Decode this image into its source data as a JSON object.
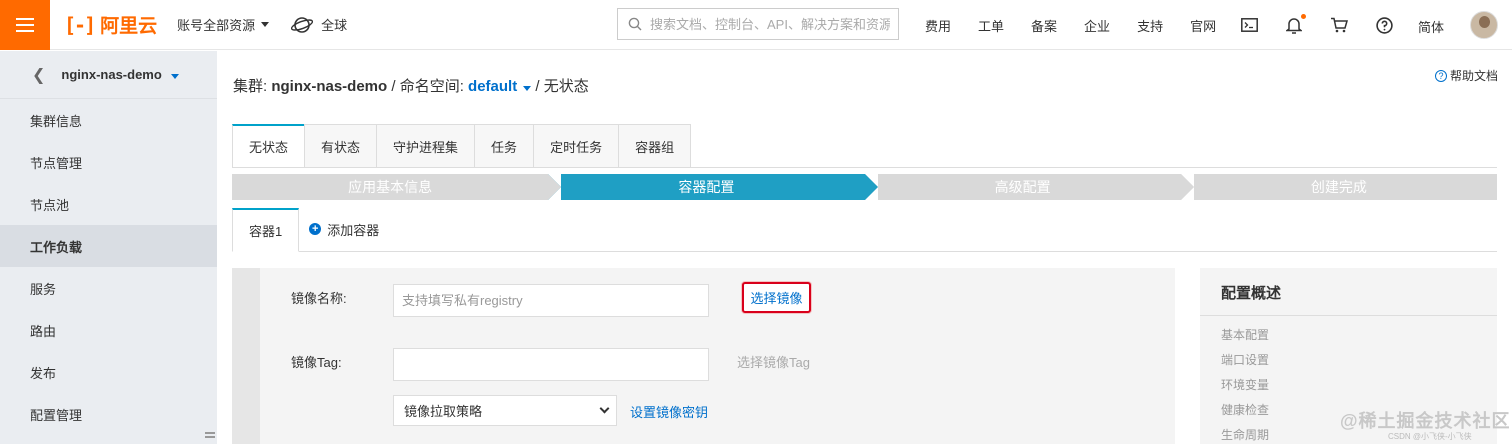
{
  "topbar": {
    "logo_mark": "[-]",
    "logo_text": "阿里云",
    "account_label": "账号全部资源",
    "region_label": "全球",
    "search_placeholder": "搜索文档、控制台、API、解决方案和资源",
    "nav": [
      "费用",
      "工单",
      "备案",
      "企业",
      "支持",
      "官网"
    ],
    "language": "简体",
    "accent": "#ff6a00"
  },
  "sidebar": {
    "cluster_name": "nginx-nas-demo",
    "items": [
      {
        "label": "集群信息"
      },
      {
        "label": "节点管理"
      },
      {
        "label": "节点池"
      },
      {
        "label": "工作负载",
        "active": true
      },
      {
        "label": "服务"
      },
      {
        "label": "路由"
      },
      {
        "label": "发布"
      },
      {
        "label": "配置管理"
      }
    ]
  },
  "breadcrumb": {
    "cluster_prefix": "集群:",
    "cluster": "nginx-nas-demo",
    "sep1": "/",
    "namespace_prefix": "命名空间:",
    "namespace": "default",
    "sep2": "/",
    "current": "无状态"
  },
  "help_link": "帮助文档",
  "tabs": [
    "无状态",
    "有状态",
    "守护进程集",
    "任务",
    "定时任务",
    "容器组"
  ],
  "steps": [
    "应用基本信息",
    "容器配置",
    "高级配置",
    "创建完成"
  ],
  "active_step": 1,
  "container_tabs": {
    "current": "容器1",
    "add_label": "添加容器"
  },
  "form": {
    "image_name_label": "镜像名称:",
    "image_name_placeholder": "支持填写私有registry",
    "select_image_button": "选择镜像",
    "image_tag_label": "镜像Tag:",
    "image_tag_value": "",
    "select_tag_link": "选择镜像Tag",
    "pull_policy_value": "镜像拉取策略",
    "set_secret_link": "设置镜像密钥"
  },
  "overview": {
    "title": "配置概述",
    "items": [
      "基本配置",
      "端口设置",
      "环境变量",
      "健康检查",
      "生命周期"
    ]
  },
  "watermark": "@稀土掘金技术社区",
  "watermark_small": "CSDN @小飞侠-小飞侠"
}
